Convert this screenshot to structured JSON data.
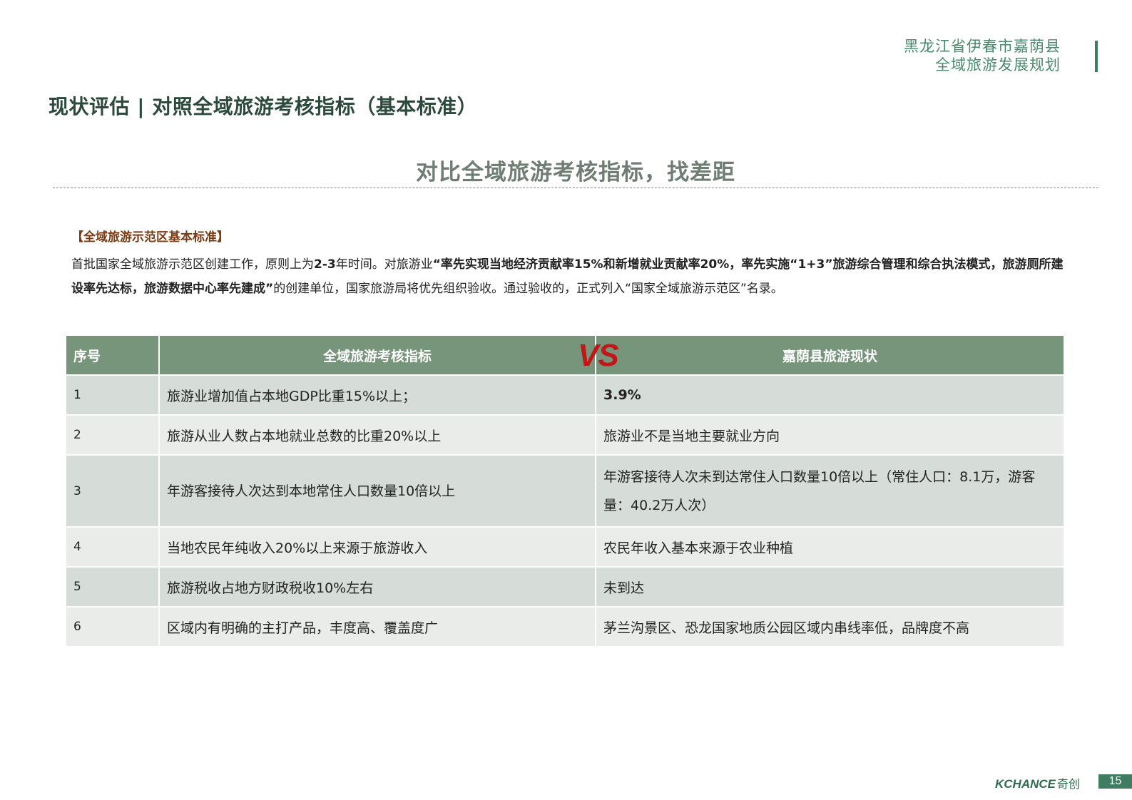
{
  "header": {
    "line1": "黑龙江省伊春市嘉荫县",
    "line2": "全域旅游发展规划"
  },
  "page_title": "现状评估 | 对照全域旅游考核指标（基本标准）",
  "section_heading": "对比全域旅游考核指标，找差距",
  "standard_label": "【全域旅游示范区基本标准】",
  "intro": {
    "p1": "首批国家全域旅游示范区创建工作，原则上为",
    "p1_years": "2-3",
    "p2": "年时间。对旅游业",
    "bold1": "“率先实现当地经济贡献率15%和新增就业贡献率20%，率先实施“1+3”旅游综合管理和综合执法模式，旅游厕所建设率先达标，旅游数据中心率先建成”",
    "p3": "的创建单位，国家旅游局将优先组织验收。通过验收的，正式列入“国家全域旅游示范区”名录。"
  },
  "table": {
    "headers": {
      "index": "序号",
      "standard": "全域旅游考核指标",
      "current": "嘉荫县旅游现状"
    },
    "vs": "VS",
    "rows": [
      {
        "index": "1",
        "standard": "旅游业增加值占本地GDP比重15%以上；",
        "current": "3.9%"
      },
      {
        "index": "2",
        "standard": "旅游从业人数占本地就业总数的比重20%以上",
        "current": "旅游业不是当地主要就业方向"
      },
      {
        "index": "3",
        "standard": "年游客接待人次达到本地常住人口数量10倍以上",
        "current": "年游客接待人次未到达常住人口数量10倍以上（常住人口：8.1万，游客量：40.2万人次）"
      },
      {
        "index": "4",
        "standard": "当地农民年纯收入20%以上来源于旅游收入",
        "current": "农民年收入基本来源于农业种植"
      },
      {
        "index": "5",
        "standard": "旅游税收占地方财政税收10%左右",
        "current": "未到达"
      },
      {
        "index": "6",
        "standard": "区域内有明确的主打产品，丰度高、覆盖度广",
        "current": "茅兰沟景区、恐龙国家地质公园区域内串线率低，品牌度不高"
      }
    ]
  },
  "footer": {
    "logo_en": "KCHANCE",
    "logo_cn": "奇创",
    "page_number": "15"
  },
  "colors": {
    "header_green": "#4a8a6c",
    "table_header": "#76957a",
    "row_dark": "#d6ddd8",
    "row_light": "#e9ece9",
    "vs_red": "#c01818",
    "label_brown": "#7a3a12"
  }
}
